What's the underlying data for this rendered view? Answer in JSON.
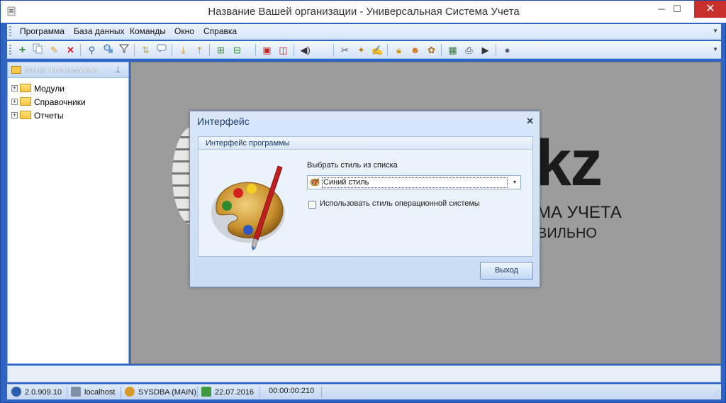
{
  "window": {
    "title": "Название Вашей организации - Универсальная Система Учета",
    "min_glyph": "─",
    "max_glyph": "☐",
    "close_glyph": "✕"
  },
  "menu": {
    "items": [
      "Программа",
      "База данных",
      "Команды",
      "Окно",
      "Справка"
    ]
  },
  "toolbar": {
    "icons": [
      "add-icon",
      "copy-icon",
      "edit-icon",
      "delete-icon",
      "find-icon",
      "find-replace-icon",
      "filter-icon",
      "sort-icon",
      "comment-icon",
      "tree-down-icon",
      "tree-up-icon",
      "import-icon",
      "export-icon",
      "window-new-icon",
      "window-close-icon",
      "sound-icon",
      "tools-icon",
      "wand-icon",
      "notepad-icon",
      "lock-icon",
      "users-icon",
      "plugin-icon",
      "calendar-icon",
      "print-icon",
      "play-icon",
      "info-icon"
    ]
  },
  "sidepanel": {
    "title": "Меню пользователя",
    "pin_glyph": "⊥",
    "items": [
      {
        "label": "Модули",
        "expander": "+"
      },
      {
        "label": "Справочники",
        "expander": "+"
      },
      {
        "label": "Отчеты",
        "expander": "+"
      }
    ]
  },
  "background": {
    "logo_text": "kz",
    "line1": "МА УЧЕТА",
    "line2": "ВИЛЬНО"
  },
  "dialog": {
    "title": "Интерфейс",
    "close_glyph": "✕",
    "group_title": "Интерфейс программы",
    "style_label": "Выбрать стиль из списка",
    "style_value": "Синий стиль",
    "combo_arrow": "▾",
    "os_style_label": "Использовать стиль операционной системы",
    "os_style_checked": false,
    "exit_button": "Выход"
  },
  "status": {
    "version": "2.0.909.10",
    "host": "localhost",
    "user": "SYSDBA (MAIN)",
    "date": "22.07.2016",
    "timer": "00:00:00:210"
  },
  "colors": {
    "frame": "#2e65c4",
    "workspace": "#9c9c9c",
    "close_button": "#c7302b"
  }
}
